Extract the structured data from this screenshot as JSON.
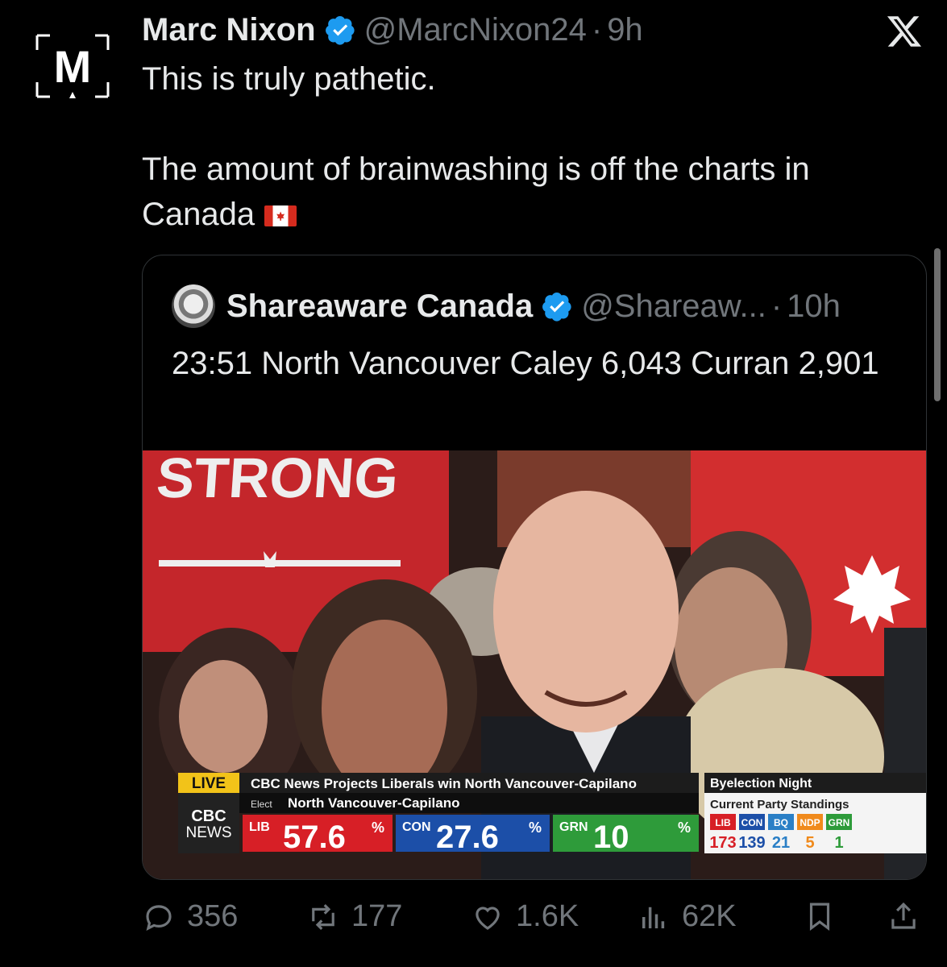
{
  "author": {
    "name": "Marc Nixon",
    "handle": "@MarcNixon24",
    "separator": "·",
    "time": "9h",
    "avatar_letter": "M"
  },
  "tweet": {
    "line1": "This is truly pathetic.",
    "line2": "The amount of brainwashing is off the charts in",
    "line3": "Canada"
  },
  "quoted": {
    "name": "Shareaware Canada",
    "handle": "@Shareaw...",
    "separator": "·",
    "time": "10h",
    "text": "23:51 North Vancouver Caley 6,043 Curran 2,901",
    "media": {
      "sign_text": "STRONG",
      "broadcast": {
        "live_label": "LIVE",
        "headline": "CBC News Projects Liberals win North Vancouver-Capilano",
        "network_line1": "CBC",
        "network_line2": "NEWS",
        "elect_label": "Elect",
        "riding": "North Vancouver-Capilano",
        "results": [
          {
            "party": "LIB",
            "value": "57.6",
            "unit": "%",
            "color": "#d71f26"
          },
          {
            "party": "CON",
            "value": "27.6",
            "unit": "%",
            "color": "#1c4fa8"
          },
          {
            "party": "GRN",
            "value": "10",
            "unit": "%",
            "color": "#2e9b3a"
          }
        ],
        "side_title": "Byelection Night",
        "standings_title": "Current Party Standings",
        "standings": [
          {
            "party": "LIB",
            "seats": "173",
            "color": "#d71f26"
          },
          {
            "party": "CON",
            "seats": "139",
            "color": "#1c4fa8"
          },
          {
            "party": "BQ",
            "seats": "21",
            "color": "#2a7fc6"
          },
          {
            "party": "NDP",
            "seats": "5",
            "color": "#f08a1c"
          },
          {
            "party": "GRN",
            "seats": "1",
            "color": "#2e9b3a"
          }
        ]
      }
    }
  },
  "actions": {
    "replies": "356",
    "reposts": "177",
    "likes": "1.6K",
    "views": "62K"
  },
  "colors": {
    "verified": "#1d9bf0",
    "muted": "#71767b",
    "text": "#e7e9ea",
    "background": "#000000"
  }
}
